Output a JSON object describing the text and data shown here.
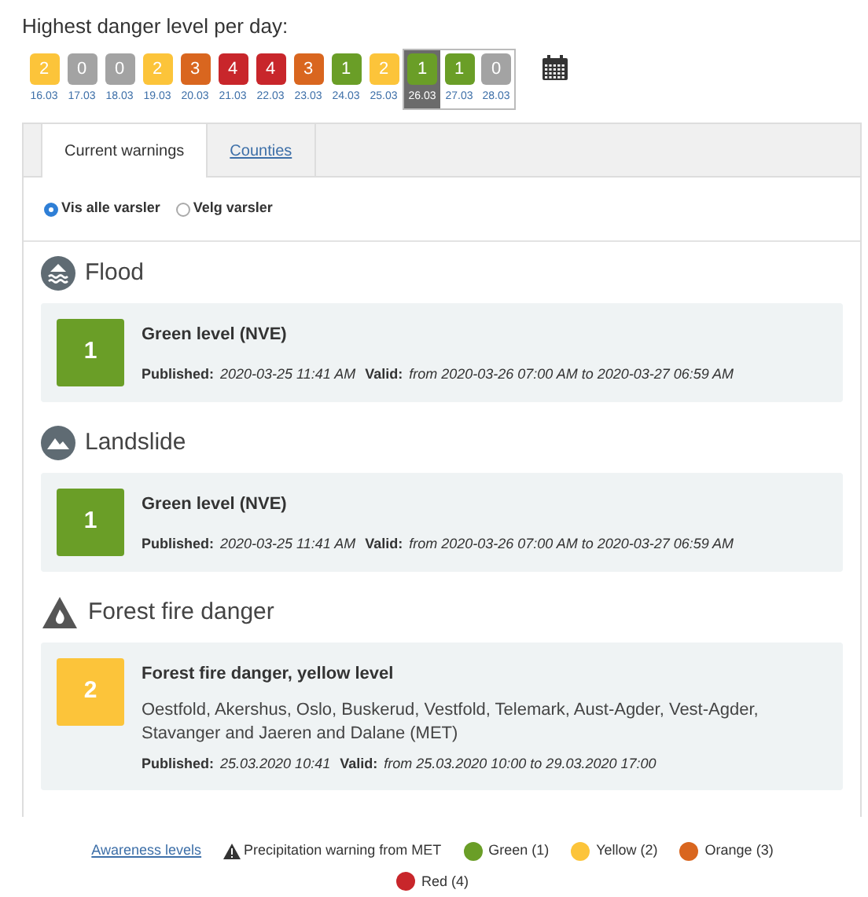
{
  "heading": "Highest danger level per day:",
  "days": [
    {
      "value": "2",
      "date": "16.03",
      "color": "#fcc43a",
      "selected": false,
      "framed": false
    },
    {
      "value": "0",
      "date": "17.03",
      "color": "#a3a3a3",
      "selected": false,
      "framed": false
    },
    {
      "value": "0",
      "date": "18.03",
      "color": "#a3a3a3",
      "selected": false,
      "framed": false
    },
    {
      "value": "2",
      "date": "19.03",
      "color": "#fcc43a",
      "selected": false,
      "framed": false
    },
    {
      "value": "3",
      "date": "20.03",
      "color": "#d9661f",
      "selected": false,
      "framed": false
    },
    {
      "value": "4",
      "date": "21.03",
      "color": "#c8262b",
      "selected": false,
      "framed": false
    },
    {
      "value": "4",
      "date": "22.03",
      "color": "#c8262b",
      "selected": false,
      "framed": false
    },
    {
      "value": "3",
      "date": "23.03",
      "color": "#d9661f",
      "selected": false,
      "framed": false
    },
    {
      "value": "1",
      "date": "24.03",
      "color": "#6a9e27",
      "selected": false,
      "framed": false
    },
    {
      "value": "2",
      "date": "25.03",
      "color": "#fcc43a",
      "selected": false,
      "framed": false
    },
    {
      "value": "1",
      "date": "26.03",
      "color": "#6a9e27",
      "selected": true,
      "framed": true
    },
    {
      "value": "1",
      "date": "27.03",
      "color": "#6a9e27",
      "selected": false,
      "framed": true
    },
    {
      "value": "0",
      "date": "28.03",
      "color": "#a3a3a3",
      "selected": false,
      "framed": true
    }
  ],
  "tabs": [
    {
      "label": "Current warnings",
      "selected": true
    },
    {
      "label": "Counties",
      "selected": false
    }
  ],
  "radios": [
    {
      "label": "Vis alle varsler",
      "selected": true
    },
    {
      "label": "Velg varsler",
      "selected": false
    }
  ],
  "sections": [
    {
      "kind": "flood",
      "title": "Flood",
      "card": {
        "value": "1",
        "color": "#6a9e27",
        "title": "Green level (NVE)",
        "published_label": "Published:",
        "published": "2020-03-25 11:41 AM",
        "valid_label": "Valid:",
        "valid": "from 2020-03-26 07:00 AM to 2020-03-27 06:59 AM"
      }
    },
    {
      "kind": "landslide",
      "title": "Landslide",
      "card": {
        "value": "1",
        "color": "#6a9e27",
        "title": "Green level (NVE)",
        "published_label": "Published:",
        "published": "2020-03-25 11:41 AM",
        "valid_label": "Valid:",
        "valid": "from 2020-03-26 07:00 AM to 2020-03-27 06:59 AM"
      }
    },
    {
      "kind": "fire",
      "title": "Forest fire danger",
      "card": {
        "value": "2",
        "color": "#fcc43a",
        "title": "Forest fire danger, yellow level",
        "areas": "Oestfold, Akershus, Oslo, Buskerud, Vestfold, Telemark, Aust-Agder, Vest-Agder, Stavanger and Jaeren and Dalane (MET)",
        "published_label": "Published:",
        "published": "25.03.2020 10:41",
        "valid_label": "Valid:",
        "valid": "from 25.03.2020 10:00 to 29.03.2020 17:00"
      }
    }
  ],
  "legend": {
    "link": "Awareness levels",
    "precipitation": "Precipitation warning from MET",
    "levels": [
      {
        "label": "Green (1)",
        "color": "#6a9e27"
      },
      {
        "label": "Yellow (2)",
        "color": "#fcc43a"
      },
      {
        "label": "Orange (3)",
        "color": "#d9661f"
      },
      {
        "label": "Red (4)",
        "color": "#c8262b"
      }
    ]
  }
}
